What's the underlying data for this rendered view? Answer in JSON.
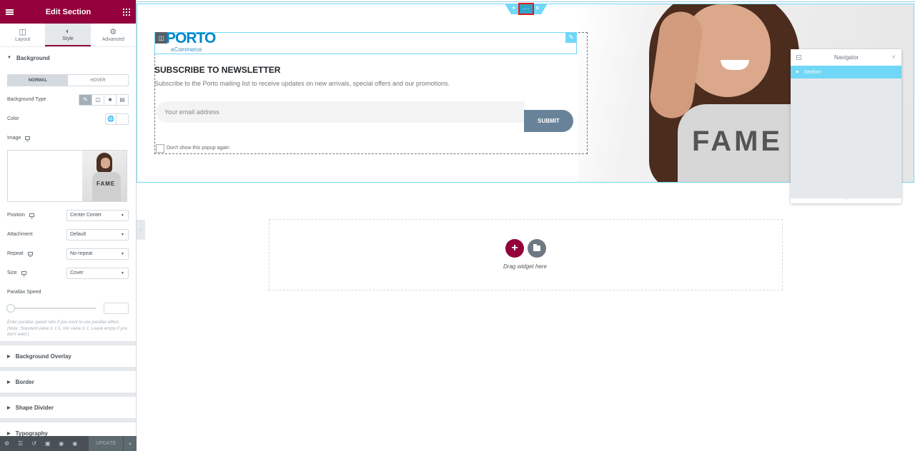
{
  "panel": {
    "title": "Edit Section",
    "tabs": [
      {
        "label": "Layout",
        "icon": "layout-icon"
      },
      {
        "label": "Style",
        "icon": "half-circle-icon"
      },
      {
        "label": "Advanced",
        "icon": "gear-icon"
      }
    ],
    "background": {
      "heading": "Background",
      "state_tabs": [
        "NORMAL",
        "HOVER"
      ],
      "background_type_label": "Background Type",
      "color_label": "Color",
      "image_label": "Image",
      "position_label": "Position",
      "position_value": "Center Center",
      "attachment_label": "Attachment",
      "attachment_value": "Default",
      "repeat_label": "Repeat",
      "repeat_value": "No-repeat",
      "size_label": "Size",
      "size_value": "Cover",
      "parallax_label": "Parallax Speed",
      "parallax_help": "Enter parallax speed ratio if you want to use parallax effect. (Note: Standard value is 1.5, min value is 1. Leave empty if you don't want.)"
    },
    "sections": [
      "Background Overlay",
      "Border",
      "Shape Divider",
      "Typography"
    ],
    "footer": {
      "update_label": "UPDATE"
    }
  },
  "canvas": {
    "logo": {
      "text": "PORTO",
      "subtext": "eCommerce"
    },
    "newsletter": {
      "title": "SUBSCRIBE TO NEWSLETTER",
      "description": "Subscribe to the Porto mailing list to receive updates on new arrivals, special offers and our promotions.",
      "email_placeholder": "Your email address",
      "submit_label": "SUBMIT",
      "checkbox_label": "Don't show this popup again"
    },
    "hero_image_text": "FAME",
    "drop_zone": {
      "text": "Drag widget here"
    }
  },
  "navigator": {
    "title": "Navigator",
    "items": [
      {
        "label": "Section"
      }
    ]
  },
  "colors": {
    "brand": "#93003c",
    "accent": "#71d7f7",
    "selection_highlight": "#e01a1a",
    "submit_button": "#688399",
    "logo": "#0088cc"
  }
}
